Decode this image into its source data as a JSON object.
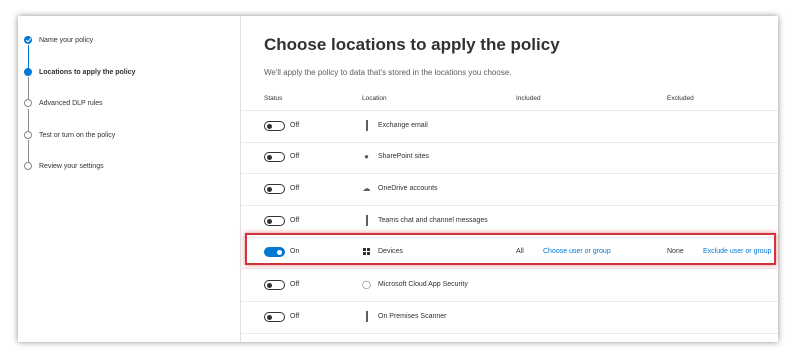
{
  "wizard": {
    "steps": [
      {
        "label": "Name your policy",
        "state": "done"
      },
      {
        "label": "Locations to apply the policy",
        "state": "current"
      },
      {
        "label": "Advanced DLP rules",
        "state": "todo"
      },
      {
        "label": "Test or turn on the policy",
        "state": "todo"
      },
      {
        "label": "Review your settings",
        "state": "todo"
      }
    ]
  },
  "main": {
    "title": "Choose locations to apply the policy",
    "subtitle": "We'll apply the policy to data that's stored in the locations you choose."
  },
  "table": {
    "headers": {
      "status": "Status",
      "location": "Location",
      "included": "Included",
      "excluded": "Excluded"
    },
    "rows": [
      {
        "state": "Off",
        "on": false,
        "location": "Exchange email",
        "icon": "exchange-icon"
      },
      {
        "state": "Off",
        "on": false,
        "location": "SharePoint sites",
        "icon": "sharepoint-icon"
      },
      {
        "state": "Off",
        "on": false,
        "location": "OneDrive accounts",
        "icon": "onedrive-icon"
      },
      {
        "state": "Off",
        "on": false,
        "location": "Teams chat and channel messages",
        "icon": "teams-icon"
      },
      {
        "state": "On",
        "on": true,
        "location": "Devices",
        "icon": "windows-icon",
        "included": "All",
        "include_link": "Choose user or group",
        "excluded": "None",
        "exclude_link": "Exclude user or group"
      },
      {
        "state": "Off",
        "on": false,
        "location": "Microsoft Cloud App Security",
        "icon": "cloud-app-security-icon"
      },
      {
        "state": "Off",
        "on": false,
        "location": "On Premises Scanner",
        "icon": "scanner-icon"
      }
    ]
  },
  "colors": {
    "accent": "#0078d4",
    "highlight": "#d13438"
  }
}
